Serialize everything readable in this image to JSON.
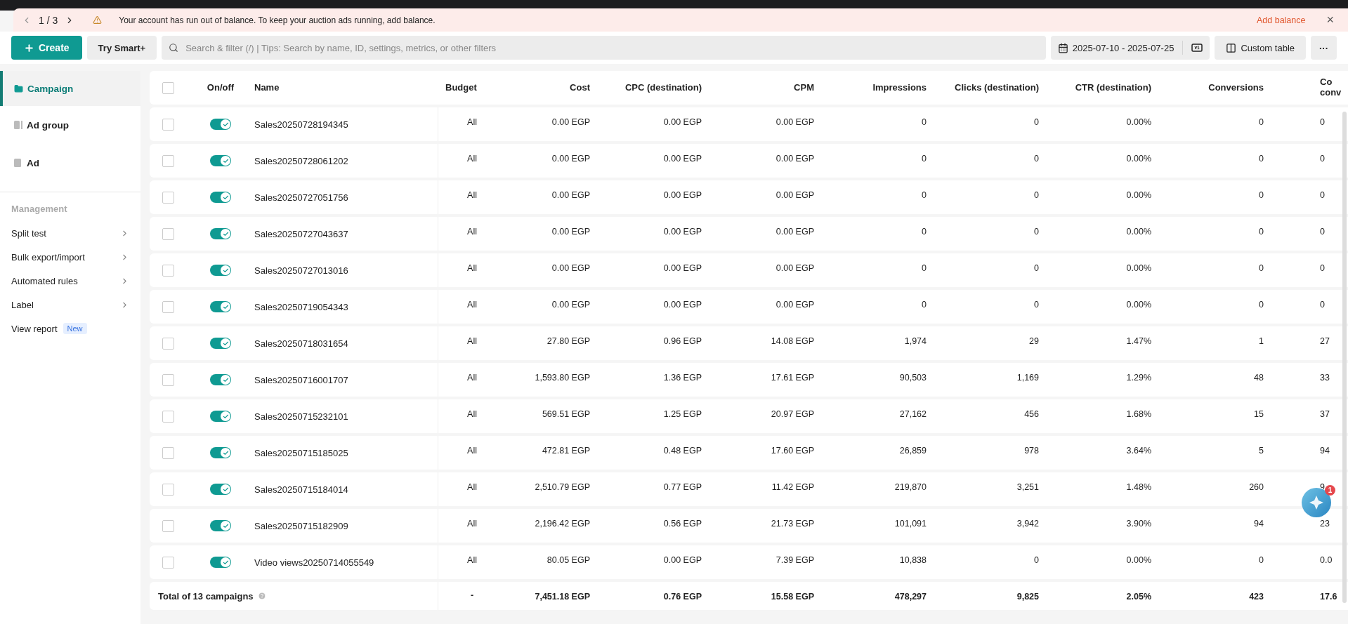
{
  "banner": {
    "pager": "1 / 3",
    "message": "Your account has run out of balance. To keep your auction ads running, add balance.",
    "link": "Add balance",
    "close": "×"
  },
  "toolbar": {
    "create": "Create",
    "smart": "Try Smart+",
    "search": {
      "placeholder": "Search & filter (/) | Tips: Search by name, ID, settings, metrics, or other filters"
    },
    "date_range": "2025-07-10 - 2025-07-25",
    "custom_table": "Custom table",
    "more": "···"
  },
  "sidebar": {
    "levels": [
      {
        "label": "Campaign",
        "selected": true
      },
      {
        "label": "Ad group",
        "selected": false
      },
      {
        "label": "Ad",
        "selected": false
      }
    ],
    "section": "Management",
    "items": [
      {
        "label": "Split test"
      },
      {
        "label": "Bulk export/import"
      },
      {
        "label": "Automated rules"
      },
      {
        "label": "Label"
      },
      {
        "label": "View report",
        "badge": "New"
      }
    ]
  },
  "table": {
    "header_checked": false,
    "toggle_header": "On/off",
    "columns": [
      "Name",
      "Budget",
      "Cost",
      "CPC (destination)",
      "CPM",
      "Impressions",
      "Clicks (destination)",
      "CTR (destination)",
      "Conversions",
      "Co conv"
    ],
    "rows": [
      {
        "checked": false,
        "on": true,
        "cells": [
          "Sales20250728194345",
          "All",
          "0.00 EGP",
          "0.00 EGP",
          "0.00 EGP",
          "0",
          "0",
          "0.00%",
          "0",
          "0"
        ]
      },
      {
        "checked": false,
        "on": true,
        "cells": [
          "Sales20250728061202",
          "All",
          "0.00 EGP",
          "0.00 EGP",
          "0.00 EGP",
          "0",
          "0",
          "0.00%",
          "0",
          "0"
        ]
      },
      {
        "checked": false,
        "on": true,
        "cells": [
          "Sales20250727051756",
          "All",
          "0.00 EGP",
          "0.00 EGP",
          "0.00 EGP",
          "0",
          "0",
          "0.00%",
          "0",
          "0"
        ]
      },
      {
        "checked": false,
        "on": true,
        "cells": [
          "Sales20250727043637",
          "All",
          "0.00 EGP",
          "0.00 EGP",
          "0.00 EGP",
          "0",
          "0",
          "0.00%",
          "0",
          "0"
        ]
      },
      {
        "checked": false,
        "on": true,
        "cells": [
          "Sales20250727013016",
          "All",
          "0.00 EGP",
          "0.00 EGP",
          "0.00 EGP",
          "0",
          "0",
          "0.00%",
          "0",
          "0"
        ]
      },
      {
        "checked": false,
        "on": true,
        "cells": [
          "Sales20250719054343",
          "All",
          "0.00 EGP",
          "0.00 EGP",
          "0.00 EGP",
          "0",
          "0",
          "0.00%",
          "0",
          "0"
        ]
      },
      {
        "checked": false,
        "on": true,
        "cells": [
          "Sales20250718031654",
          "All",
          "27.80 EGP",
          "0.96 EGP",
          "14.08 EGP",
          "1,974",
          "29",
          "1.47%",
          "1",
          "27"
        ]
      },
      {
        "checked": false,
        "on": true,
        "cells": [
          "Sales20250716001707",
          "All",
          "1,593.80 EGP",
          "1.36 EGP",
          "17.61 EGP",
          "90,503",
          "1,169",
          "1.29%",
          "48",
          "33"
        ]
      },
      {
        "checked": false,
        "on": true,
        "cells": [
          "Sales20250715232101",
          "All",
          "569.51 EGP",
          "1.25 EGP",
          "20.97 EGP",
          "27,162",
          "456",
          "1.68%",
          "15",
          "37"
        ]
      },
      {
        "checked": false,
        "on": true,
        "cells": [
          "Sales20250715185025",
          "All",
          "472.81 EGP",
          "0.48 EGP",
          "17.60 EGP",
          "26,859",
          "978",
          "3.64%",
          "5",
          "94"
        ]
      },
      {
        "checked": false,
        "on": true,
        "cells": [
          "Sales20250715184014",
          "All",
          "2,510.79 EGP",
          "0.77 EGP",
          "11.42 EGP",
          "219,870",
          "3,251",
          "1.48%",
          "260",
          "9"
        ]
      },
      {
        "checked": false,
        "on": true,
        "cells": [
          "Sales20250715182909",
          "All",
          "2,196.42 EGP",
          "0.56 EGP",
          "21.73 EGP",
          "101,091",
          "3,942",
          "3.90%",
          "94",
          "23"
        ]
      },
      {
        "checked": false,
        "on": true,
        "cells": [
          "Video views20250714055549",
          "All",
          "80.05 EGP",
          "0.00 EGP",
          "7.39 EGP",
          "10,838",
          "0",
          "0.00%",
          "0",
          "0.0"
        ]
      }
    ],
    "total": {
      "cells": [
        "Total of 13 campaigns",
        "-",
        "7,451.18 EGP",
        "0.76 EGP",
        "15.58 EGP",
        "478,297",
        "9,825",
        "2.05%",
        "423",
        "17.6"
      ]
    }
  },
  "chat_widget": {
    "badge": "1"
  }
}
